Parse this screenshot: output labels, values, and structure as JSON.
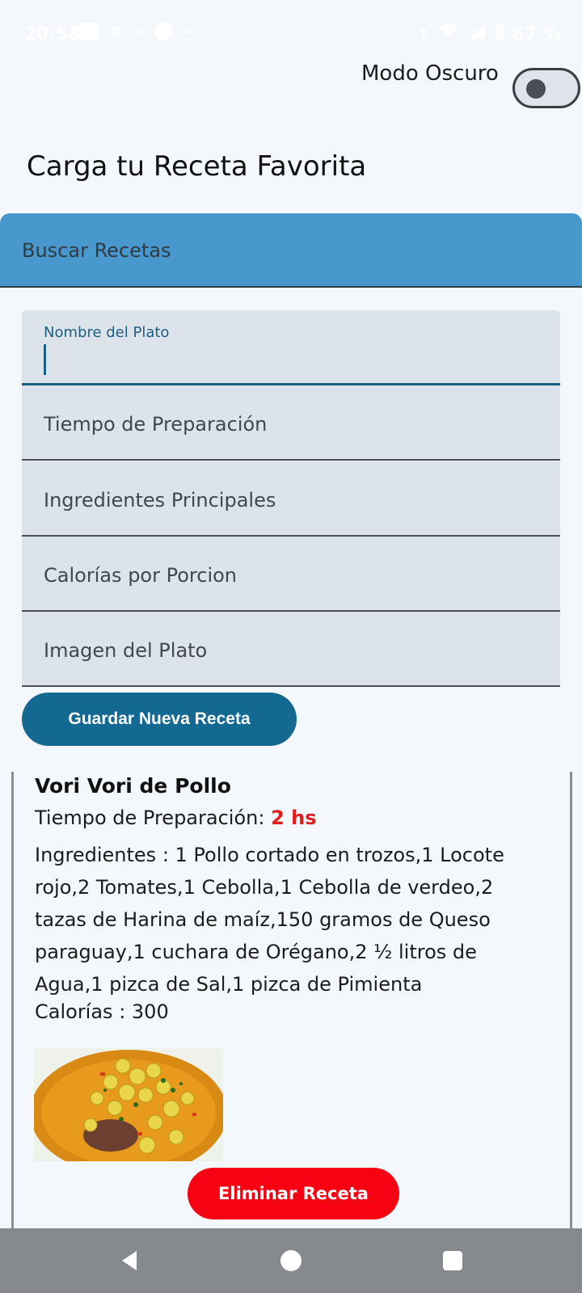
{
  "status_bar": {
    "time": "20:58",
    "battery": "67 %",
    "icons": [
      "gallery-icon",
      "sim-icon",
      "mail-icon",
      "whatsapp-icon",
      "dot-icon",
      "data-speed-icon",
      "wifi-icon",
      "signal-icon",
      "battery-icon"
    ]
  },
  "header": {
    "dark_mode_label": "Modo Oscuro",
    "dark_mode_on": false,
    "title": "Carga tu Receta Favorita"
  },
  "search": {
    "label": "Buscar Recetas",
    "accent": "#4898ce"
  },
  "form": {
    "name_label": "Nombre del Plato",
    "name_value": "",
    "time_placeholder": "Tiempo de Preparación",
    "ingredients_placeholder": "Ingredientes Principales",
    "calories_placeholder": "Calorías por Porcion",
    "image_placeholder": "Imagen del Plato",
    "save_label": "Guardar Nueva Receta"
  },
  "recipe": {
    "name": "Vori Vori de Pollo",
    "time_label": "Tiempo de Preparación: ",
    "time_value": "2 hs",
    "ingredients": "Ingredientes : 1 Pollo cortado en trozos,1 Locote rojo,2 Tomates,1 Cebolla,1 Cebolla de verdeo,2 tazas de Harina de maíz,150 gramos de Queso paraguay,1 cuchara de Orégano,2 ½ litros de Agua,1 pizca de Sal,1 pizca de Pimienta",
    "calories": "Calorías : 300",
    "delete_label": "Eliminar Receta",
    "delete_color": "#f60212"
  },
  "nav": {
    "icons": [
      "back-icon",
      "home-icon",
      "recents-icon"
    ]
  }
}
